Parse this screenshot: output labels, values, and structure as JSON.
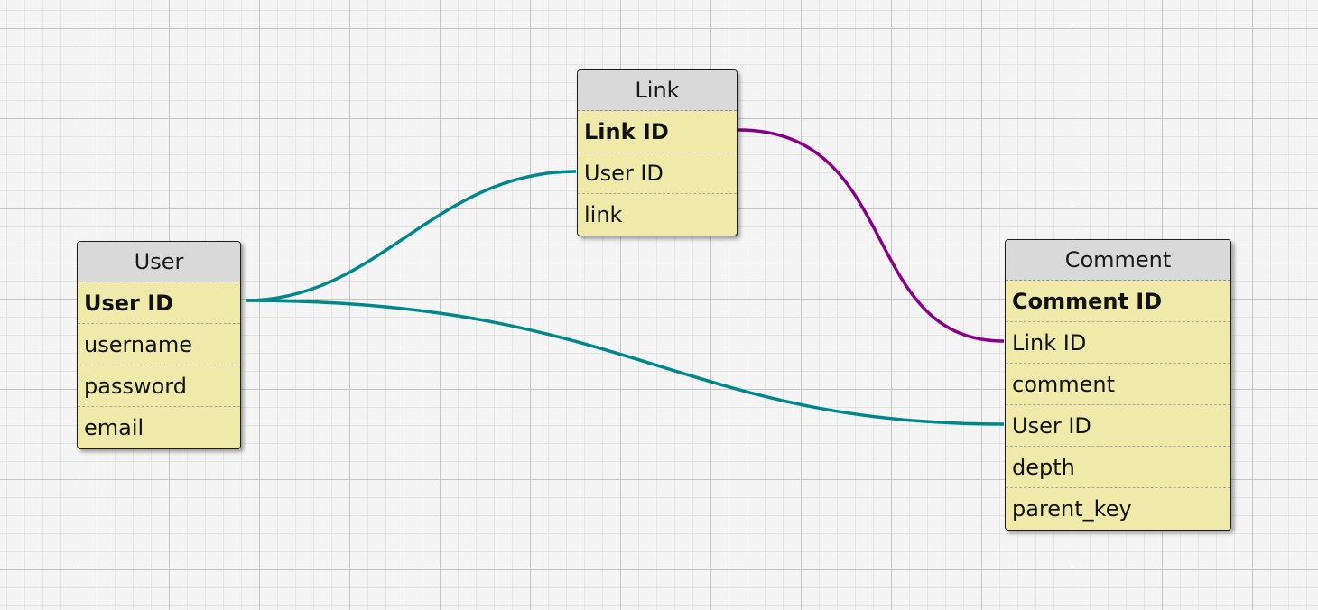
{
  "entities": {
    "user": {
      "title": "User",
      "fields": [
        "User ID",
        "username",
        "password",
        "email"
      ]
    },
    "link": {
      "title": "Link",
      "fields": [
        "Link ID",
        "User ID",
        "link"
      ]
    },
    "comment": {
      "title": "Comment",
      "fields": [
        "Comment ID",
        "Link ID",
        "comment",
        "User ID",
        "depth",
        "parent_key"
      ]
    }
  },
  "relationships": [
    {
      "from": "User.User ID",
      "to": "Link.User ID",
      "color": "#00878a"
    },
    {
      "from": "User.User ID",
      "to": "Comment.User ID",
      "color": "#00878a"
    },
    {
      "from": "Link.Link ID",
      "to": "Comment.Link ID",
      "color": "#880088"
    }
  ]
}
